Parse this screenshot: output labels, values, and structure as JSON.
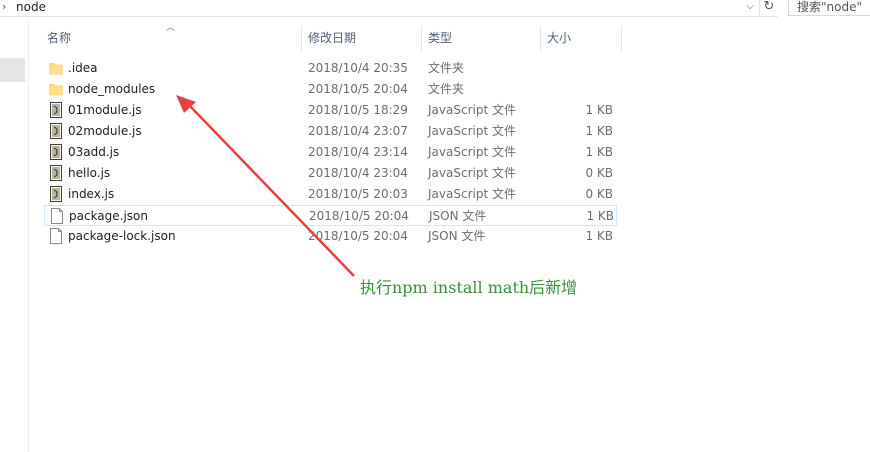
{
  "address": {
    "path": "node",
    "search_placeholder": "搜索\"node\""
  },
  "columns": {
    "name": "名称",
    "date": "修改日期",
    "type": "类型",
    "size": "大小"
  },
  "files": [
    {
      "name": ".idea",
      "date": "2018/10/4 20:35",
      "type": "文件夹",
      "size": "",
      "icon": "folder-icon"
    },
    {
      "name": "node_modules",
      "date": "2018/10/5 20:04",
      "type": "文件夹",
      "size": "",
      "icon": "folder-icon"
    },
    {
      "name": "01module.js",
      "date": "2018/10/5 18:29",
      "type": "JavaScript 文件",
      "size": "1 KB",
      "icon": "js-file-icon"
    },
    {
      "name": "02module.js",
      "date": "2018/10/4 23:07",
      "type": "JavaScript 文件",
      "size": "1 KB",
      "icon": "js-file-icon"
    },
    {
      "name": "03add.js",
      "date": "2018/10/4 23:14",
      "type": "JavaScript 文件",
      "size": "1 KB",
      "icon": "js-file-icon"
    },
    {
      "name": "hello.js",
      "date": "2018/10/4 23:04",
      "type": "JavaScript 文件",
      "size": "0 KB",
      "icon": "js-file-icon"
    },
    {
      "name": "index.js",
      "date": "2018/10/5 20:03",
      "type": "JavaScript 文件",
      "size": "0 KB",
      "icon": "js-file-icon"
    },
    {
      "name": "package.json",
      "date": "2018/10/5 20:04",
      "type": "JSON 文件",
      "size": "1 KB",
      "icon": "json-file-icon"
    },
    {
      "name": "package-lock.json",
      "date": "2018/10/5 20:04",
      "type": "JSON 文件",
      "size": "1 KB",
      "icon": "json-file-icon"
    }
  ],
  "selected_index": 7,
  "annotation": {
    "text": "执行npm install math后新增",
    "color": "#3e8e3e",
    "arrow_color": "#e8413d"
  }
}
